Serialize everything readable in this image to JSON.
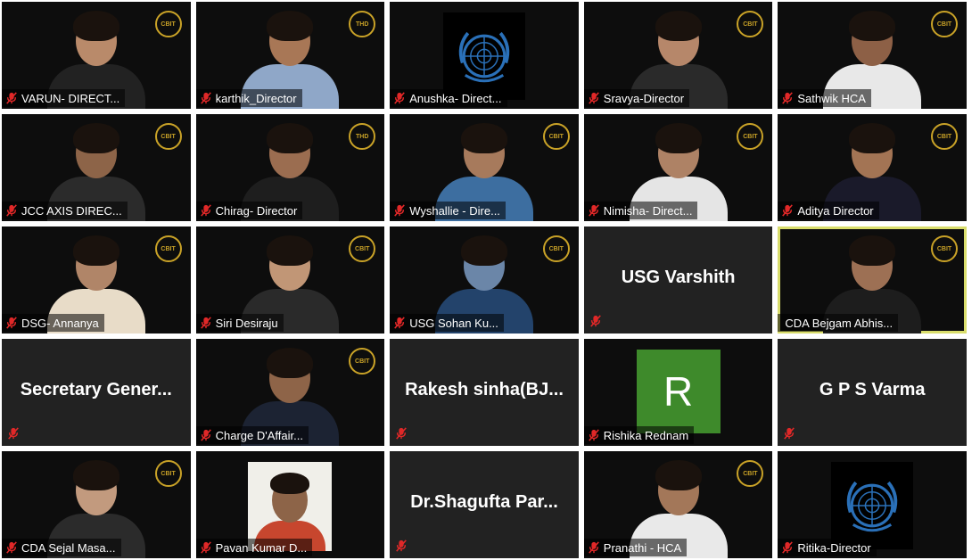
{
  "participants": [
    {
      "name": "VARUN- DIRECT...",
      "type": "video",
      "logo": "CBIT",
      "skin": "#b98a6a",
      "shirt": "#222",
      "muted": true
    },
    {
      "name": "karthik_Director",
      "type": "video",
      "logo": "THD",
      "skin": "#a87756",
      "shirt": "#8fa7c8",
      "muted": true
    },
    {
      "name": "Anushka- Direct...",
      "type": "emblem",
      "emblem": "un-emblem-icon",
      "muted": true
    },
    {
      "name": "Sravya-Director",
      "type": "video",
      "logo": "CBIT",
      "skin": "#b6876a",
      "shirt": "#2a2a2a",
      "muted": true
    },
    {
      "name": "Sathwik HCA",
      "type": "video",
      "logo": "CBIT",
      "skin": "#8d6046",
      "shirt": "#e8e8e8",
      "muted": true
    },
    {
      "name": "JCC AXIS DIREC...",
      "type": "video",
      "logo": "CBIT",
      "skin": "#8d6448",
      "shirt": "#2b2b2b",
      "muted": true
    },
    {
      "name": "Chirag- Director",
      "type": "video",
      "logo": "THD",
      "skin": "#9b6d50",
      "shirt": "#1e1e1e",
      "muted": true
    },
    {
      "name": "Wyshallie - Dire...",
      "type": "video",
      "logo": "CBIT",
      "skin": "#a77a5c",
      "shirt": "#3d6ea0",
      "muted": true
    },
    {
      "name": "Nimisha- Direct...",
      "type": "video",
      "logo": "CBIT",
      "skin": "#ae8265",
      "shirt": "#e5e5e5",
      "muted": true
    },
    {
      "name": "Aditya Director",
      "type": "video",
      "logo": "CBIT",
      "skin": "#a37454",
      "shirt": "#1a1a2a",
      "muted": true
    },
    {
      "name": "DSG- Annanya",
      "type": "video",
      "logo": "CBIT",
      "skin": "#b08568",
      "shirt": "#e8dcc8",
      "muted": true
    },
    {
      "name": "Siri Desiraju",
      "type": "video",
      "logo": "CBIT",
      "skin": "#c19676",
      "shirt": "#2a2a2a",
      "muted": true
    },
    {
      "name": "USG Sohan Ku...",
      "type": "video",
      "logo": "CBIT",
      "skin": "#6b86a8",
      "shirt": "#23436b",
      "muted": true
    },
    {
      "name": "USG Varshith",
      "type": "text",
      "muted": true
    },
    {
      "name": "CDA Bejgam Abhis...",
      "type": "video",
      "logo": "CBIT",
      "skin": "#9d7054",
      "shirt": "#1d1d1d",
      "muted": false,
      "active": true
    },
    {
      "name": "Secretary  Gener...",
      "type": "text",
      "muted": true
    },
    {
      "name": "Charge D'Affair...",
      "type": "video",
      "logo": "CBIT",
      "skin": "#8e6448",
      "shirt": "#1c2333",
      "muted": true
    },
    {
      "name": "Rakesh  sinha(BJ...",
      "type": "text",
      "muted": true
    },
    {
      "name": "Rishika Rednam",
      "type": "avatar",
      "initial": "R",
      "muted": true
    },
    {
      "name": "G P S Varma",
      "type": "text",
      "muted": true
    },
    {
      "name": "CDA Sejal Masa...",
      "type": "video",
      "logo": "CBIT",
      "skin": "#c29a7e",
      "shirt": "#2b2b2b",
      "muted": true
    },
    {
      "name": "Pavan Kumar D...",
      "type": "photo",
      "skin": "#8d6448",
      "muted": true
    },
    {
      "name": "Dr.Shagufta  Par...",
      "type": "text",
      "muted": true
    },
    {
      "name": "Pranathi - HCA",
      "type": "video",
      "logo": "CBIT",
      "skin": "#a37759",
      "shirt": "#e9e9e9",
      "muted": true
    },
    {
      "name": "Ritika-Director",
      "type": "emblem",
      "emblem": "un-emblem-icon",
      "muted": true
    }
  ],
  "colors": {
    "tile_bg": "#0d0d0d",
    "text_tile_bg": "#222222",
    "active_border": "#d9dd6c",
    "muted_icon": "#e02828",
    "logo_gold": "#c9a227",
    "avatar_green": "#3e8a2b",
    "emblem_blue": "#2a70b8"
  }
}
